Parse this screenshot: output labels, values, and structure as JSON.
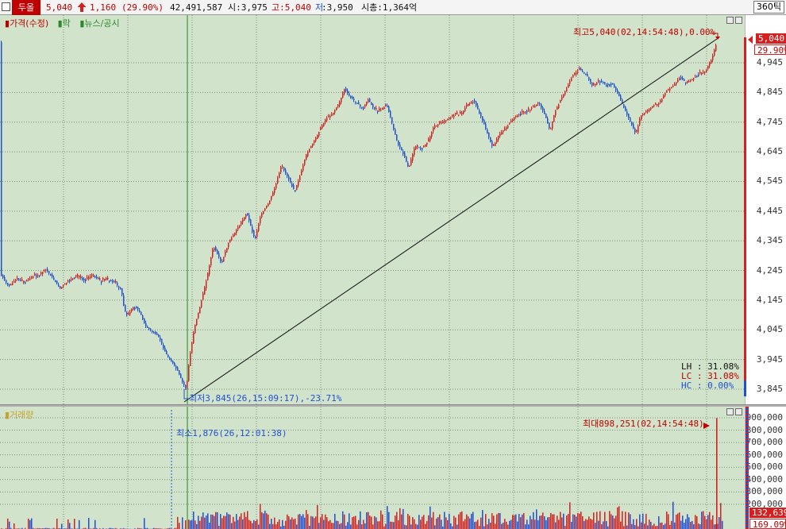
{
  "header": {
    "stock_name": "두올",
    "price": "5,040",
    "change": "1,160",
    "change_pct": "(29.90%)",
    "volume": "42,491,587",
    "open": "시:3,975",
    "high": "고:5,040",
    "low_prefix": "저",
    "low_value": ":3,950",
    "market_cap": "시총:1,364억",
    "interval": "360틱"
  },
  "price_pane": {
    "legend": [
      "가격(수정)",
      "락",
      "뉴스/공시"
    ],
    "axis_ticks": [
      "4,945",
      "4,845",
      "4,745",
      "4,645",
      "4,545",
      "4,445",
      "4,345",
      "4,245",
      "4,145",
      "4,045",
      "3,945",
      "3,845"
    ],
    "current_price_badge": "5,040",
    "current_pct_badge": "29.90%",
    "max_label": "최고5,040(02,14:54:48),0.00%",
    "min_label": "최저3,845(26,15:09:17),-23.71%",
    "stats": [
      {
        "name": "LH",
        "value": "31.08%"
      },
      {
        "name": "LC",
        "value": "31.08%"
      },
      {
        "name": "HC",
        "value": "0.00%"
      }
    ]
  },
  "volume_pane": {
    "legend": "거래량",
    "axis_ticks": [
      "900,000",
      "800,000",
      "700,000",
      "600,000",
      "500,000",
      "400,000",
      "300,000",
      "200,000"
    ],
    "current_volume_badge": "132,639",
    "pct_badge": "169.09%",
    "max_label": "최대898,251(02,14:54:48)",
    "min_label": "최소1,876(26,12:01:38)"
  },
  "colors": {
    "up": "#d42020",
    "down": "#1f4fd6",
    "background": "#d1e3ca",
    "grid": "#7f8f7a",
    "title_bar": "#c00000"
  }
}
